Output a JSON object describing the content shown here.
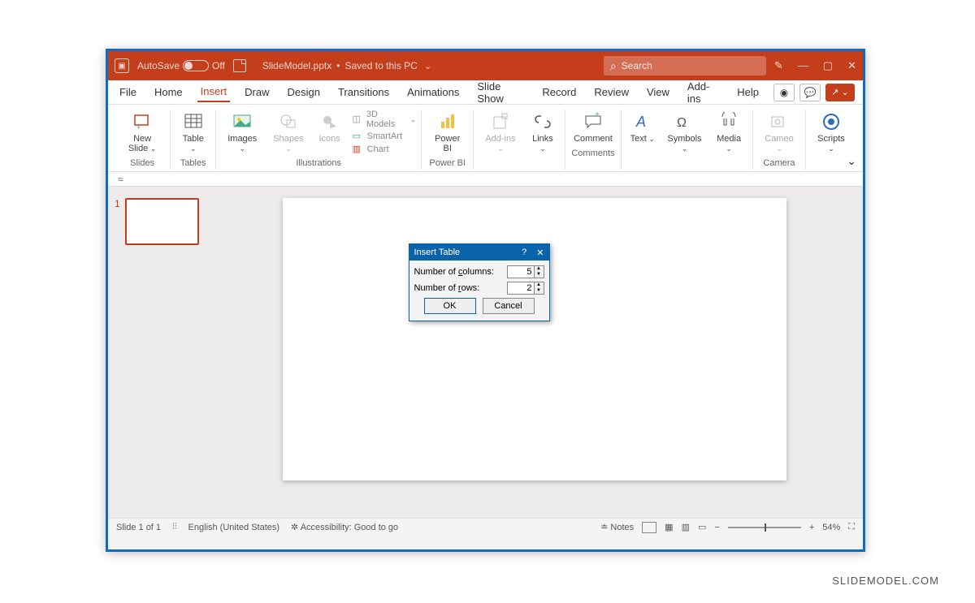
{
  "titlebar": {
    "autosave_label": "AutoSave",
    "autosave_state": "Off",
    "filename": "SlideModel.pptx",
    "save_status": "Saved to this PC",
    "search_placeholder": "Search"
  },
  "menu": {
    "file": "File",
    "home": "Home",
    "insert": "Insert",
    "draw": "Draw",
    "design": "Design",
    "transitions": "Transitions",
    "animations": "Animations",
    "slideshow": "Slide Show",
    "record": "Record",
    "review": "Review",
    "view": "View",
    "addins": "Add-ins",
    "help": "Help"
  },
  "ribbon": {
    "new_slide": "New Slide",
    "table": "Table",
    "images": "Images",
    "shapes": "Shapes",
    "icons": "Icons",
    "models3d": "3D Models",
    "smartart": "SmartArt",
    "chart": "Chart",
    "powerbi": "Power BI",
    "addins": "Add-ins",
    "links": "Links",
    "comment": "Comment",
    "text": "Text",
    "symbols": "Symbols",
    "media": "Media",
    "cameo": "Cameo",
    "scripts": "Scripts",
    "group_slides": "Slides",
    "group_tables": "Tables",
    "group_illustrations": "Illustrations",
    "group_powerbi": "Power BI",
    "group_comments": "Comments",
    "group_camera": "Camera"
  },
  "thumb": {
    "num": "1"
  },
  "dialog": {
    "title": "Insert Table",
    "cols_label_pre": "Number of ",
    "cols_label_u": "c",
    "cols_label_post": "olumns:",
    "rows_label_pre": "Number of ",
    "rows_label_u": "r",
    "rows_label_post": "ows:",
    "cols_value": "5",
    "rows_value": "2",
    "ok": "OK",
    "cancel": "Cancel"
  },
  "status": {
    "slide": "Slide 1 of 1",
    "lang": "English (United States)",
    "access": "Accessibility: Good to go",
    "notes": "Notes",
    "zoom": "54%"
  },
  "watermark": "SLIDEMODEL.COM"
}
